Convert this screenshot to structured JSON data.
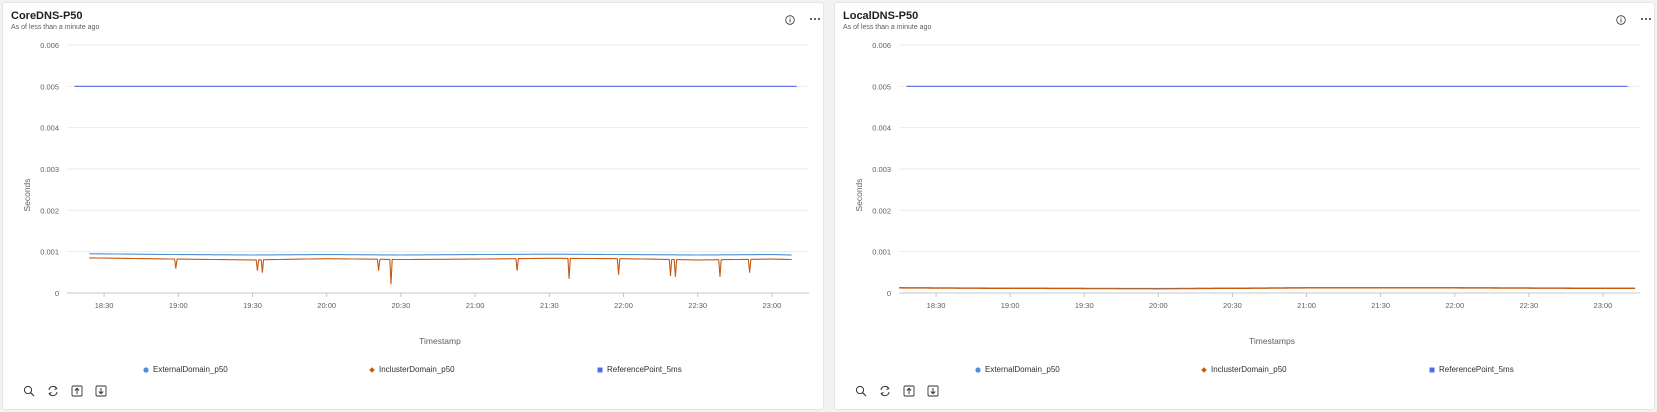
{
  "panels": [
    {
      "title": "CoreDNS-P50",
      "subtitle": "As of less than a minute ago",
      "info_icon": "info-circle-icon",
      "more_icon": "ellipsis-icon"
    },
    {
      "title": "LocalDNS-P50",
      "subtitle": "As of less than a minute ago",
      "info_icon": "info-circle-icon",
      "more_icon": "ellipsis-icon"
    }
  ],
  "toolbar_icons": [
    "zoom-icon",
    "refresh-icon",
    "upload-icon",
    "download-icon"
  ],
  "chart_data": [
    {
      "type": "line",
      "title": "CoreDNS-P50",
      "subtitle": "As of less than a minute ago",
      "xlabel": "Timestamp",
      "ylabel": "Seconds",
      "ylim": [
        0,
        0.006
      ],
      "yticks": [
        "0",
        "0.001",
        "0.002",
        "0.003",
        "0.004",
        "0.005",
        "0.006"
      ],
      "xlim": [
        "18:15",
        "23:15"
      ],
      "xticks": [
        "18:30",
        "19:00",
        "19:30",
        "20:00",
        "20:30",
        "21:00",
        "21:30",
        "22:00",
        "22:30",
        "23:00"
      ],
      "grid": true,
      "legend": "bottom",
      "series": [
        {
          "name": "ExternalDomain_p50",
          "color": "#4a90d9",
          "marker": "circle",
          "x": [
            "18:24",
            "19:00",
            "19:30",
            "20:00",
            "20:30",
            "21:00",
            "21:30",
            "22:00",
            "22:30",
            "23:00",
            "23:08"
          ],
          "values": [
            0.00095,
            0.00093,
            0.00092,
            0.00093,
            0.00092,
            0.00093,
            0.00094,
            0.00093,
            0.00092,
            0.00093,
            0.00092
          ]
        },
        {
          "name": "InclusterDomain_p50",
          "color": "#c55a11",
          "marker": "diamond",
          "x": [
            "18:24",
            "19:00",
            "19:30",
            "20:00",
            "20:30",
            "21:00",
            "21:30",
            "22:00",
            "22:30",
            "23:00",
            "23:08"
          ],
          "values": [
            0.00085,
            0.00082,
            0.0008,
            0.00083,
            0.00081,
            0.00082,
            0.00084,
            0.00083,
            0.0008,
            0.00082,
            0.00081
          ],
          "dips": [
            {
              "x": "18:59",
              "value": 0.0006
            },
            {
              "x": "19:32",
              "value": 0.00055
            },
            {
              "x": "19:34",
              "value": 0.0005
            },
            {
              "x": "20:21",
              "value": 0.00055
            },
            {
              "x": "20:26",
              "value": 0.00022
            },
            {
              "x": "21:17",
              "value": 0.00055
            },
            {
              "x": "21:38",
              "value": 0.00035
            },
            {
              "x": "21:58",
              "value": 0.00045
            },
            {
              "x": "22:19",
              "value": 0.00042
            },
            {
              "x": "22:21",
              "value": 0.0004
            },
            {
              "x": "22:39",
              "value": 0.0004
            },
            {
              "x": "22:51",
              "value": 0.0005
            }
          ]
        },
        {
          "name": "ReferencePoint_5ms",
          "color": "#4f6bed",
          "marker": "square",
          "x": [
            "18:18",
            "23:10"
          ],
          "values": [
            0.005,
            0.005
          ]
        }
      ]
    },
    {
      "type": "line",
      "title": "LocalDNS-P50",
      "subtitle": "As of less than a minute ago",
      "xlabel": "Timestamps",
      "ylabel": "Seconds",
      "ylim": [
        0,
        0.006
      ],
      "yticks": [
        "0",
        "0.001",
        "0.002",
        "0.003",
        "0.004",
        "0.005",
        "0.006"
      ],
      "xlim": [
        "18:15",
        "23:15"
      ],
      "xticks": [
        "18:30",
        "19:00",
        "19:30",
        "20:00",
        "20:30",
        "21:00",
        "21:30",
        "22:00",
        "22:30",
        "23:00"
      ],
      "grid": true,
      "legend": "bottom",
      "series": [
        {
          "name": "ExternalDomain_p50",
          "color": "#4a90d9",
          "marker": "circle",
          "x": [
            "18:15",
            "19:00",
            "20:00",
            "20:30",
            "21:00",
            "22:00",
            "23:00",
            "23:13"
          ],
          "values": [
            0.00013,
            0.00012,
            0.00011,
            0.00012,
            0.00013,
            0.00013,
            0.00012,
            0.00012
          ]
        },
        {
          "name": "InclusterDomain_p50",
          "color": "#c55a11",
          "marker": "diamond",
          "x": [
            "18:15",
            "19:00",
            "20:00",
            "20:30",
            "21:00",
            "22:00",
            "23:00",
            "23:13"
          ],
          "values": [
            0.00012,
            0.00011,
            0.0001,
            0.00011,
            0.00012,
            0.00012,
            0.00011,
            0.00011
          ]
        },
        {
          "name": "ReferencePoint_5ms",
          "color": "#4f6bed",
          "marker": "square",
          "x": [
            "18:18",
            "23:10"
          ],
          "values": [
            0.005,
            0.005
          ]
        }
      ]
    }
  ]
}
